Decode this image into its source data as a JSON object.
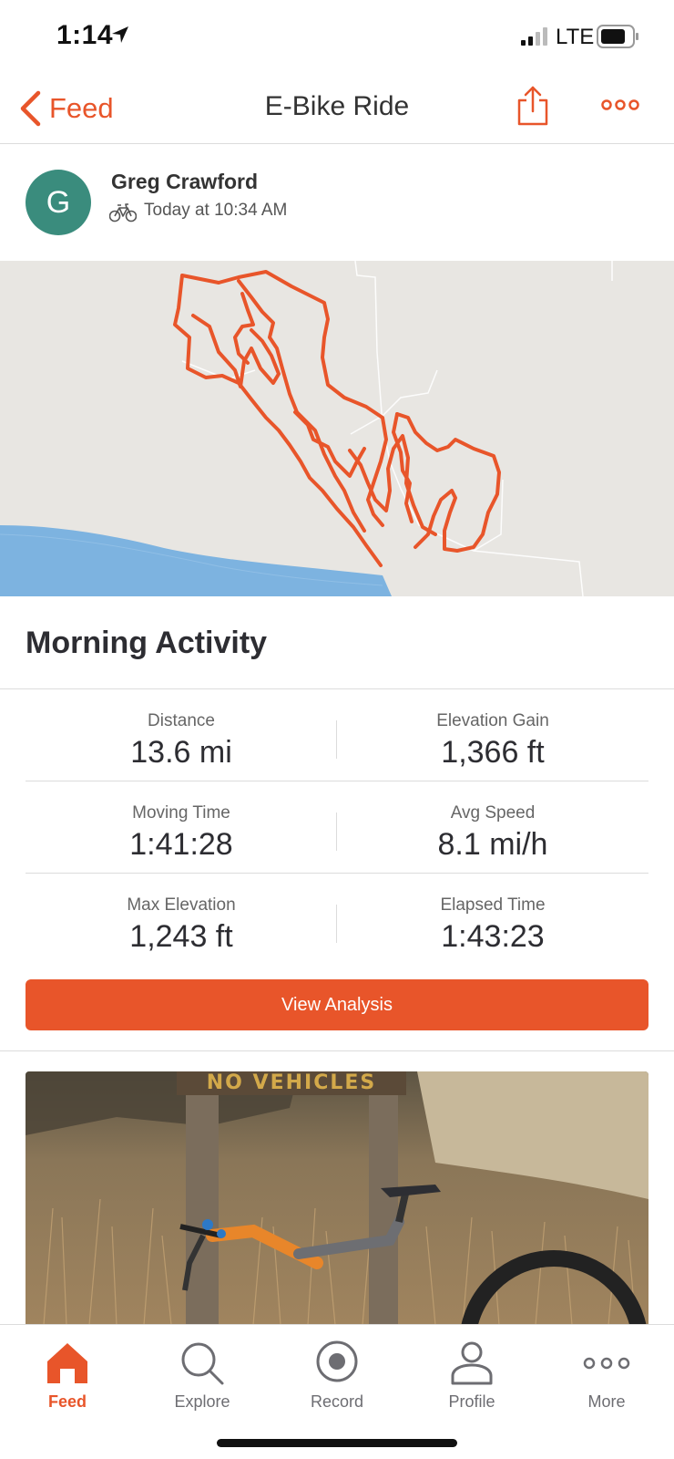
{
  "status_bar": {
    "time": "1:14",
    "network": "LTE"
  },
  "nav": {
    "back_label": "Feed",
    "title": "E-Bike Ride"
  },
  "athlete": {
    "initial": "G",
    "name": "Greg Crawford",
    "activity_time": "Today at 10:34 AM"
  },
  "activity": {
    "title": "Morning Activity"
  },
  "stats": [
    {
      "label": "Distance",
      "value": "13.6 mi"
    },
    {
      "label": "Elevation Gain",
      "value": "1,366 ft"
    },
    {
      "label": "Moving Time",
      "value": "1:41:28"
    },
    {
      "label": "Avg Speed",
      "value": "8.1 mi/h"
    },
    {
      "label": "Max Elevation",
      "value": "1,243 ft"
    },
    {
      "label": "Elapsed Time",
      "value": "1:43:23"
    }
  ],
  "analysis_button": {
    "label": "View Analysis"
  },
  "photo": {
    "sign_text": "NO VEHICLES"
  },
  "tabs": [
    {
      "label": "Feed",
      "icon": "home-icon",
      "active": true
    },
    {
      "label": "Explore",
      "icon": "search-icon",
      "active": false
    },
    {
      "label": "Record",
      "icon": "record-icon",
      "active": false
    },
    {
      "label": "Profile",
      "icon": "profile-icon",
      "active": false
    },
    {
      "label": "More",
      "icon": "more-dots-icon",
      "active": false
    }
  ],
  "colors": {
    "accent": "#e8552a",
    "avatar": "#3a8c7d",
    "map_background": "#e8e6e2",
    "water": "#7db3e0",
    "route": "#e8552a"
  }
}
